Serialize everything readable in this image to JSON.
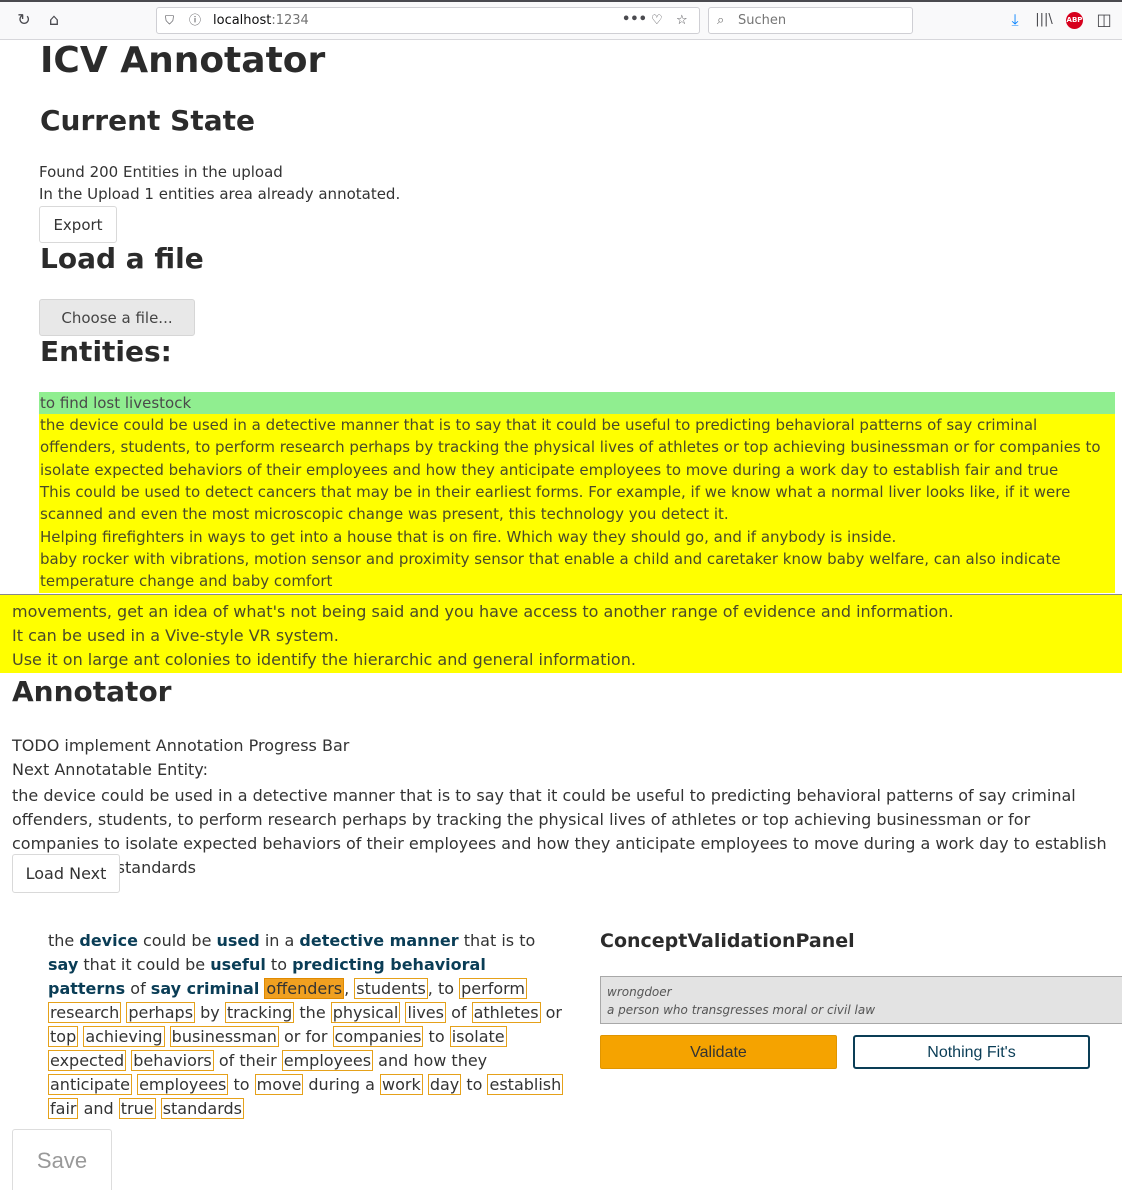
{
  "browser": {
    "url_host": "localhost",
    "url_port": ":1234",
    "search_placeholder": "Suchen",
    "abp_label": "ABP",
    "dots": "•••"
  },
  "app": {
    "title": "ICV Annotator"
  },
  "current_state": {
    "heading": "Current State",
    "entities_found": "Found 200 Entities in the upload",
    "already_annotated": "In the Upload 1 entities area already annotated.",
    "export_label": "Export"
  },
  "load_file": {
    "heading": "Load a file",
    "choose_label": "Choose a file..."
  },
  "entities": {
    "heading": "Entities:",
    "upper_rows": [
      "to find lost livestock",
      "the device could be used in a detective manner that is to say that it could be useful to predicting behavioral patterns of say criminal offenders, students, to perform research perhaps by tracking the physical lives of athletes or top achieving businessman or for companies to isolate expected behaviors of their employees and how they anticipate employees to move during a work day to establish fair and true standards",
      "This could be used to detect cancers that may be in their earliest forms. For example, if we know what a normal liver looks like, if it were scanned and even the most microscopic change was present, this technology you detect it.",
      "Helping firefighters in ways to get into a house that is on fire. Which way they should go, and if anybody is inside.",
      "baby rocker with vibrations, motion sensor and proximity sensor that enable a child and caretaker know baby welfare, can also indicate temperature change and baby comfort"
    ],
    "lower_rows": [
      "movements, get an idea of what's not being said and you have access to another range of evidence and information.",
      "It can be used in a Vive-style VR system.",
      "Use it on large ant colonies to identify the hierarchic and general information."
    ]
  },
  "annotator": {
    "heading": "Annotator",
    "todo": "TODO implement Annotation Progress Bar",
    "next_label": "Next Annotatable Entity:",
    "next_text": "the device could be used in a detective manner that is to say that it could be useful to predicting behavioral patterns of say criminal offenders, students, to perform research perhaps by tracking the physical lives of athletes or top achieving businessman or for companies to isolate expected behaviors of their employees and how they anticipate employees to move during a work day to establish fair and true standards",
    "load_next_label": "Load Next",
    "tokens": [
      {
        "t": "the",
        "s": "plain"
      },
      {
        "t": " ",
        "s": "sp"
      },
      {
        "t": "device",
        "s": "bold"
      },
      {
        "t": " could be ",
        "s": "plain"
      },
      {
        "t": "used",
        "s": "bold"
      },
      {
        "t": " in a ",
        "s": "plain"
      },
      {
        "t": "detective manner",
        "s": "bold"
      },
      {
        "t": " that is to ",
        "s": "plain"
      },
      {
        "t": "say",
        "s": "bold"
      },
      {
        "t": " that it could be ",
        "s": "plain"
      },
      {
        "t": "useful",
        "s": "bold"
      },
      {
        "t": " to ",
        "s": "plain"
      },
      {
        "t": "predicting behavioral patterns",
        "s": "bold"
      },
      {
        "t": " of ",
        "s": "plain"
      },
      {
        "t": "say criminal",
        "s": "bold"
      },
      {
        "t": " ",
        "s": "sp"
      },
      {
        "t": "offenders",
        "s": "sel"
      },
      {
        "t": ", ",
        "s": "plain"
      },
      {
        "t": "students",
        "s": "box"
      },
      {
        "t": ", to ",
        "s": "plain"
      },
      {
        "t": "perform",
        "s": "box"
      },
      {
        "t": " ",
        "s": "sp"
      },
      {
        "t": "research",
        "s": "box"
      },
      {
        "t": " ",
        "s": "sp"
      },
      {
        "t": "perhaps",
        "s": "box"
      },
      {
        "t": " by ",
        "s": "plain"
      },
      {
        "t": "tracking",
        "s": "box"
      },
      {
        "t": " the ",
        "s": "plain"
      },
      {
        "t": "physical",
        "s": "box"
      },
      {
        "t": " ",
        "s": "sp"
      },
      {
        "t": "lives",
        "s": "box"
      },
      {
        "t": " of ",
        "s": "plain"
      },
      {
        "t": "athletes",
        "s": "box"
      },
      {
        "t": " or ",
        "s": "plain"
      },
      {
        "t": "top",
        "s": "box"
      },
      {
        "t": " ",
        "s": "sp"
      },
      {
        "t": "achieving",
        "s": "box"
      },
      {
        "t": " ",
        "s": "sp"
      },
      {
        "t": "businessman",
        "s": "box"
      },
      {
        "t": " or for ",
        "s": "plain"
      },
      {
        "t": "companies",
        "s": "box"
      },
      {
        "t": " to ",
        "s": "plain"
      },
      {
        "t": "isolate",
        "s": "box"
      },
      {
        "t": " ",
        "s": "sp"
      },
      {
        "t": "expected",
        "s": "box"
      },
      {
        "t": " ",
        "s": "sp"
      },
      {
        "t": "behaviors",
        "s": "box"
      },
      {
        "t": " of their ",
        "s": "plain"
      },
      {
        "t": "employees",
        "s": "box"
      },
      {
        "t": " and how ",
        "s": "plain"
      },
      {
        "t": "they ",
        "s": "plain"
      },
      {
        "t": "anticipate",
        "s": "box"
      },
      {
        "t": " ",
        "s": "sp"
      },
      {
        "t": "employees",
        "s": "box"
      },
      {
        "t": " to ",
        "s": "plain"
      },
      {
        "t": "move",
        "s": "box"
      },
      {
        "t": " during a ",
        "s": "plain"
      },
      {
        "t": "work",
        "s": "box"
      },
      {
        "t": " ",
        "s": "sp"
      },
      {
        "t": "day",
        "s": "box"
      },
      {
        "t": " to ",
        "s": "plain"
      },
      {
        "t": "establish",
        "s": "box"
      },
      {
        "t": " ",
        "s": "sp"
      },
      {
        "t": "fair",
        "s": "box"
      },
      {
        "t": " ",
        "s": "sp"
      },
      {
        "t": "and ",
        "s": "plain"
      },
      {
        "t": "true",
        "s": "box"
      },
      {
        "t": " ",
        "s": "sp"
      },
      {
        "t": "standards",
        "s": "box"
      }
    ]
  },
  "concept_panel": {
    "heading": "ConceptValidationPanel",
    "concept": "wrongdoer",
    "definition": "a person who transgresses moral or civil law",
    "validate_label": "Validate",
    "nofit_label": "Nothing Fit's"
  },
  "save_label": "Save",
  "colors": {
    "green_row": "#90ee90",
    "yellow_row": "#ffff00",
    "validate": "#f5a300",
    "accent_dark": "#0a3d56"
  }
}
